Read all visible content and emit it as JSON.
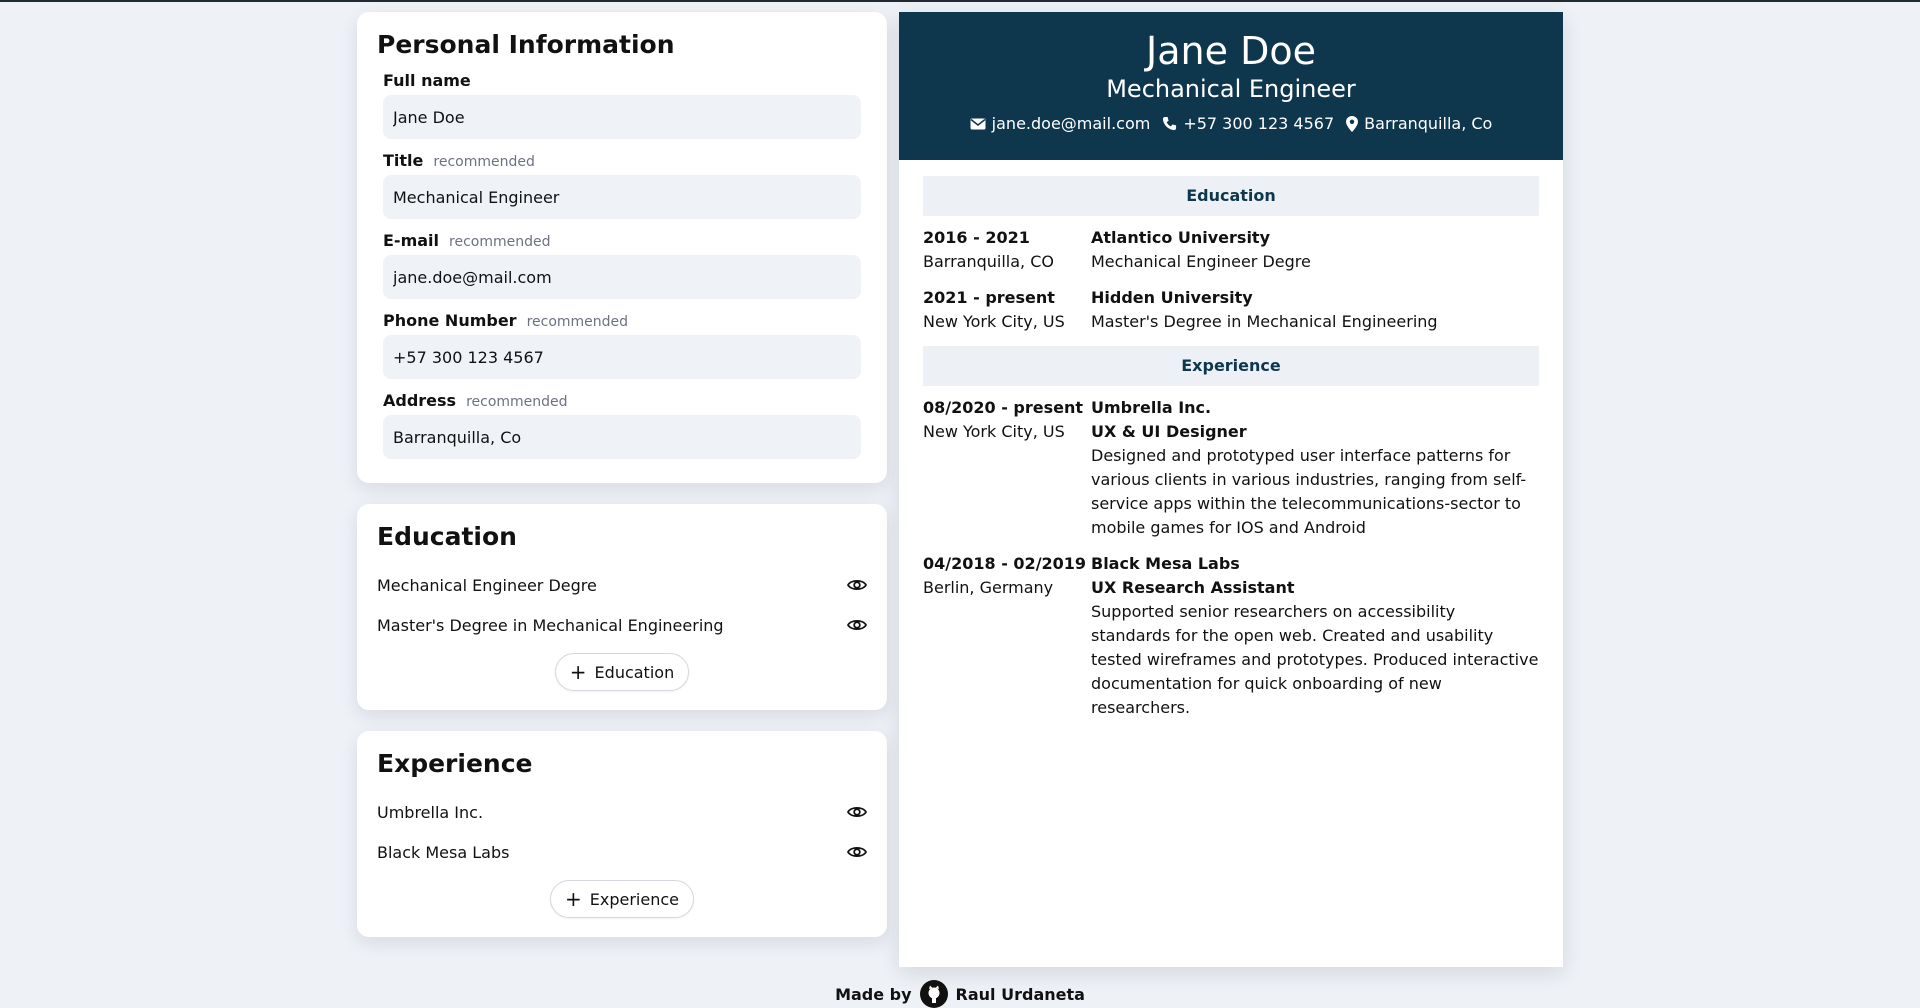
{
  "personal": {
    "heading": "Personal Information",
    "fields": [
      {
        "label": "Full name",
        "note": "",
        "value": "Jane Doe"
      },
      {
        "label": "Title",
        "note": "recommended",
        "value": "Mechanical Engineer"
      },
      {
        "label": "E-mail",
        "note": "recommended",
        "value": "jane.doe@mail.com"
      },
      {
        "label": "Phone Number",
        "note": "recommended",
        "value": "+57 300 123 4567"
      },
      {
        "label": "Address",
        "note": "recommended",
        "value": "Barranquilla, Co"
      }
    ]
  },
  "education": {
    "heading": "Education",
    "items": [
      {
        "label": "Mechanical Engineer Degre",
        "icon": "eye-icon"
      },
      {
        "label": "Master's Degree in Mechanical Engineering",
        "icon": "eye-icon"
      }
    ],
    "add_label": "Education"
  },
  "experience": {
    "heading": "Experience",
    "items": [
      {
        "label": "Umbrella Inc.",
        "icon": "eye-icon"
      },
      {
        "label": "Black Mesa Labs",
        "icon": "eye-icon"
      }
    ],
    "add_label": "Experience"
  },
  "cv": {
    "name": "Jane Doe",
    "title": "Mechanical Engineer",
    "email": "jane.doe@mail.com",
    "phone": "+57 300 123 4567",
    "address": "Barranquilla, Co",
    "education_title": "Education",
    "education": [
      {
        "dates": "2016 - 2021",
        "place": "Barranquilla, CO",
        "school": "Atlantico University",
        "degree": "Mechanical Engineer Degre"
      },
      {
        "dates": "2021 - present",
        "place": "New York City, US",
        "school": "Hidden University",
        "degree": "Master's Degree in Mechanical Engineering"
      }
    ],
    "experience_title": "Experience",
    "experience": [
      {
        "dates": "08/2020 - present",
        "place": "New York City, US",
        "company": "Umbrella Inc.",
        "role": "UX & UI Designer",
        "desc": "Designed and prototyped user interface patterns for various clients in various industries, ranging from self-service apps within the telecommunications-sector to mobile games for IOS and Android"
      },
      {
        "dates": "04/2018 - 02/2019",
        "place": "Berlin, Germany",
        "company": "Black Mesa Labs",
        "role": "UX Research Assistant",
        "desc": "Supported senior researchers on accessibility standards for the open web. Created and usability tested wireframes and prototypes. Produced interactive documentation for quick onboarding of new researchers."
      }
    ]
  },
  "footer": {
    "made_by": "Made by",
    "author": "Raul Urdaneta"
  },
  "colors": {
    "header_bg": "#0e374e",
    "page_bg": "#eef2f7",
    "section_bg": "#edf1f5"
  }
}
